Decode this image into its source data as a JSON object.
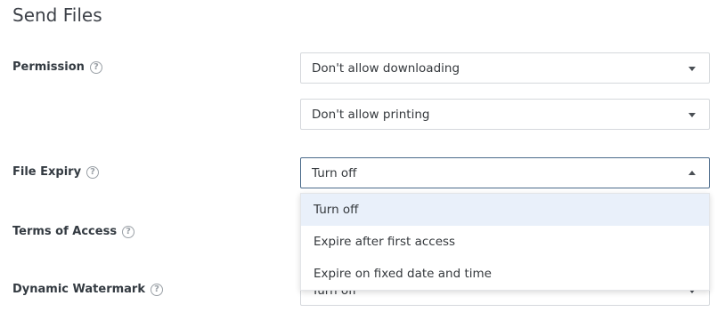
{
  "page": {
    "title": "Send Files"
  },
  "permission": {
    "label": "Permission",
    "download_select": "Don't allow downloading",
    "print_select": "Don't allow printing"
  },
  "file_expiry": {
    "label": "File Expiry",
    "select_value": "Turn off",
    "options": [
      "Turn off",
      "Expire after first access",
      "Expire on fixed date and time"
    ],
    "selected_option": "Turn off"
  },
  "terms_of_access": {
    "label": "Terms of Access"
  },
  "dynamic_watermark": {
    "label": "Dynamic Watermark",
    "select_value": "Turn off"
  },
  "icons": {
    "help": "?"
  },
  "colors": {
    "selected_option_bg": "#e9f0fa",
    "active_border": "#4a6a8a"
  }
}
